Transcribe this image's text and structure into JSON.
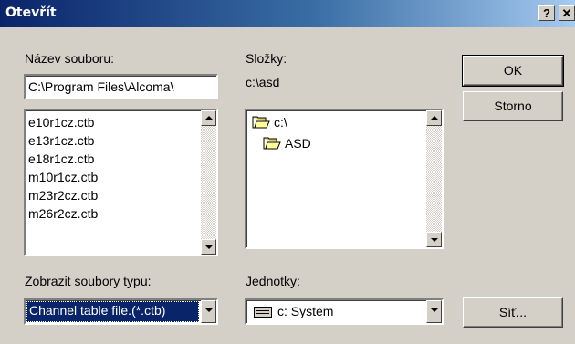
{
  "window": {
    "title": "Otevřít",
    "help_label": "?",
    "close_label": "✕"
  },
  "filename": {
    "label": "Název souboru:",
    "value": "C:\\Program Files\\Alcoma\\",
    "files": [
      "e10r1cz.ctb",
      "e13r1cz.ctb",
      "e18r1cz.ctb",
      "m10r1cz.ctb",
      "m23r2cz.ctb",
      "m26r2cz.ctb"
    ]
  },
  "folders": {
    "label": "Složky:",
    "current": "c:\\asd",
    "items": [
      {
        "name": "c:\\",
        "icon": "open-folder-icon"
      },
      {
        "name": "ASD",
        "icon": "open-folder-icon"
      }
    ]
  },
  "filetype": {
    "label": "Zobrazit soubory typu:",
    "value": "Channel table file.(*.ctb)"
  },
  "drives": {
    "label": "Jednotky:",
    "value": "c: System",
    "icon": "drive-icon"
  },
  "buttons": {
    "ok": "OK",
    "cancel": "Storno",
    "network": "Síť..."
  }
}
